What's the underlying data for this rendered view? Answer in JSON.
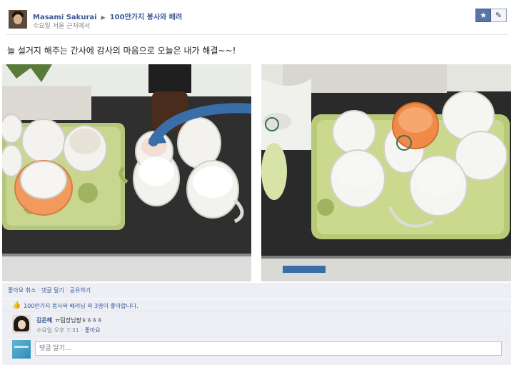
{
  "header": {
    "author": "Masami Sakurai",
    "group": "100만가지 봉사와 배려",
    "meta": "수요일 서울 근처에서"
  },
  "post": {
    "text": "늘 설거지 해주는 간사에 감사의 마음으로 오늘은 내가 해결~~!"
  },
  "feedback": {
    "links": [
      "좋아요 취소",
      "댓글 달기",
      "공유하기"
    ],
    "likes_text": "100만가지 봉사와 배려님 외 3명이 좋아합니다.",
    "comment": {
      "name": "김은혜",
      "text": "ㅠ팀장님짱ㅎㅎㅎㅎ",
      "time": "수요일 오후 7:31",
      "like_label": "좋아요"
    },
    "reply_placeholder": "댓글 달기..."
  },
  "icons": {
    "star": "star-icon",
    "edit": "pencil-icon",
    "arrow": "triangle-right-icon",
    "thumb": "thumbs-up-icon"
  },
  "colors": {
    "link": "#3b5998",
    "feedback_bg": "#edeff4"
  }
}
